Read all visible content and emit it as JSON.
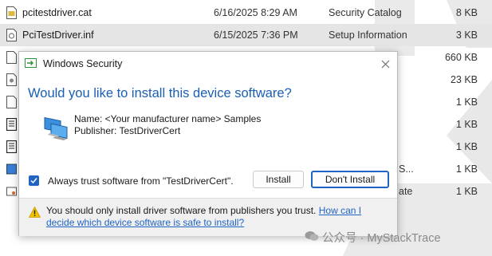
{
  "explorer": {
    "files": [
      {
        "name": "pcitestdriver.cat",
        "date": "6/16/2025 8:29 AM",
        "type": "Security Catalog",
        "size": "8 KB",
        "icon": "catalog-file-icon",
        "selected": false
      },
      {
        "name": "PciTestDriver.inf",
        "date": "6/15/2025 7:36 PM",
        "type": "Setup Information",
        "size": "3 KB",
        "icon": "setup-file-icon",
        "selected": true
      },
      {
        "name": "",
        "date": "",
        "type": "",
        "size": "660 KB",
        "icon": "blank-file-icon",
        "selected": false
      },
      {
        "name": "",
        "date": "",
        "type": "",
        "size": "23 KB",
        "icon": "config-file-icon",
        "selected": false
      },
      {
        "name": "",
        "date": "",
        "type": "",
        "size": "1 KB",
        "icon": "blank-file-icon",
        "selected": false
      },
      {
        "name": "",
        "date": "",
        "type": "",
        "size": "1 KB",
        "icon": "script-file-icon",
        "selected": false
      },
      {
        "name": "",
        "date": "",
        "type": "",
        "size": "1 KB",
        "icon": "script-file-icon",
        "selected": false
      },
      {
        "name": "",
        "date": "",
        "type": "S...",
        "size": "1 KB",
        "icon": "image-file-icon",
        "selected": false
      },
      {
        "name": "",
        "date": "",
        "type": "ate",
        "size": "1 KB",
        "icon": "cert-file-icon",
        "selected": false
      }
    ]
  },
  "dialog": {
    "title": "Windows Security",
    "close_icon": "close-icon",
    "question": "Would you like to install this device software?",
    "name_line": "Name: <Your manufacturer name> Samples",
    "publisher_line": "Publisher: TestDriverCert",
    "always_trust_label": "Always trust software from \"TestDriverCert\".",
    "always_trust_checked": true,
    "install_label": "Install",
    "dont_install_label": "Don't Install",
    "warning_text": "You should only install driver software from publishers you trust.",
    "warning_link": "How can I decide which device software is safe to install?",
    "accent_color": "#1f63c3"
  },
  "watermark": {
    "text": "公众号 · MyStackTrace"
  }
}
